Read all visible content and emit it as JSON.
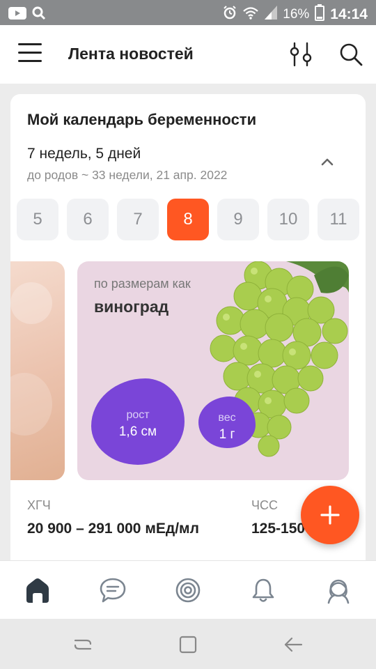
{
  "status_bar": {
    "battery_percent": "16%",
    "time": "14:14",
    "icons": [
      "youtube-icon",
      "search-icon",
      "alarm-icon",
      "wifi-icon",
      "signal-icon",
      "battery-icon"
    ]
  },
  "app_bar": {
    "title": "Лента новостей",
    "icons": [
      "menu-icon",
      "filter-icon",
      "search-icon"
    ]
  },
  "calendar_card": {
    "title": "Мой календарь беременности",
    "term": "7 недель, 5 дней",
    "due": "до родов ~ 33 недели, 21 апр. 2022",
    "weeks": [
      "5",
      "6",
      "7",
      "8",
      "9",
      "10",
      "11"
    ],
    "active_week": "8",
    "size_label": "по размерам как",
    "fruit": "виноград",
    "height_label": "рост",
    "height_value": "1,6 см",
    "weight_label": "вес",
    "weight_value": "1 г",
    "hcg_label": "ХГЧ",
    "hcg_value": "20 900 – 291 000 мЕд/мл",
    "hr_label": "ЧСС",
    "hr_value": "125-150"
  },
  "bottom_nav": {
    "items": [
      "home-icon",
      "chat-icon",
      "target-icon",
      "bell-icon",
      "profile-icon"
    ],
    "active": "home-icon"
  },
  "colors": {
    "accent": "#ff5722",
    "purple": "#7a45d8",
    "slide_bg": "#ead6e2",
    "active_nav": "#2f3a44"
  }
}
